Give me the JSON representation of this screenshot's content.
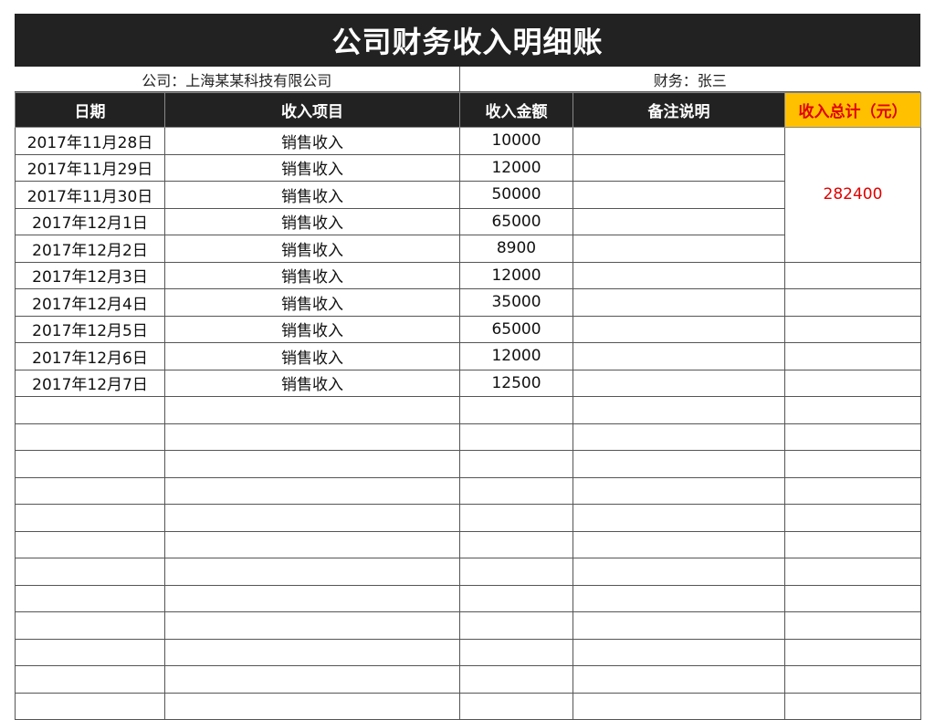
{
  "title": "公司财务收入明细账",
  "info": {
    "company": "公司：上海某某科技有限公司",
    "finance": "财务：张三"
  },
  "columns": [
    "日期",
    "收入项目",
    "收入金额",
    "备注说明",
    "收入总计（元）"
  ],
  "rows": [
    {
      "date": "2017年11月28日",
      "item": "销售收入",
      "amount": "10000",
      "note": ""
    },
    {
      "date": "2017年11月29日",
      "item": "销售收入",
      "amount": "12000",
      "note": ""
    },
    {
      "date": "2017年11月30日",
      "item": "销售收入",
      "amount": "50000",
      "note": ""
    },
    {
      "date": "2017年12月1日",
      "item": "销售收入",
      "amount": "65000",
      "note": ""
    },
    {
      "date": "2017年12月2日",
      "item": "销售收入",
      "amount": "8900",
      "note": ""
    },
    {
      "date": "2017年12月3日",
      "item": "销售收入",
      "amount": "12000",
      "note": ""
    },
    {
      "date": "2017年12月4日",
      "item": "销售收入",
      "amount": "35000",
      "note": ""
    },
    {
      "date": "2017年12月5日",
      "item": "销售收入",
      "amount": "65000",
      "note": ""
    },
    {
      "date": "2017年12月6日",
      "item": "销售收入",
      "amount": "12000",
      "note": ""
    },
    {
      "date": "2017年12月7日",
      "item": "销售收入",
      "amount": "12500",
      "note": ""
    }
  ],
  "total": "282400",
  "colors": {
    "header_bg": "#222222",
    "total_header_bg": "#ffc000",
    "total_text": "#e00000"
  }
}
